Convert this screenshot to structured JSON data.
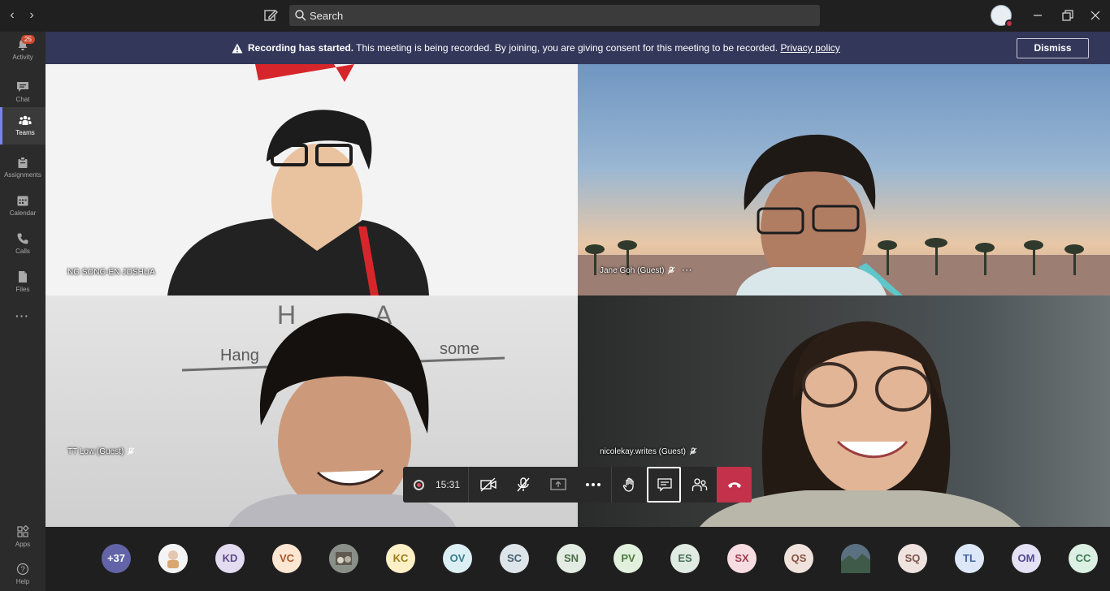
{
  "topbar": {
    "search_placeholder": "Search"
  },
  "rail": {
    "items": [
      {
        "label": "Activity",
        "badge": "25"
      },
      {
        "label": "Chat"
      },
      {
        "label": "Teams"
      },
      {
        "label": "Assignments"
      },
      {
        "label": "Calendar"
      },
      {
        "label": "Calls"
      },
      {
        "label": "Files"
      },
      {
        "label": "Apps"
      },
      {
        "label": "Help"
      }
    ]
  },
  "banner": {
    "bold": "Recording has started.",
    "text": " This meeting is being recorded. By joining, you are giving consent for this meeting to be recorded. ",
    "link": "Privacy policy",
    "dismiss": "Dismiss"
  },
  "tiles": [
    {
      "name": "NG SONG-EN JOSHUA"
    },
    {
      "name": "Jane Goh (Guest)"
    },
    {
      "name": "TT Low (Guest)"
    },
    {
      "name": "nicolekay.writes (Guest)"
    }
  ],
  "controls": {
    "timer": "15:31"
  },
  "participants": [
    {
      "initials": "+37",
      "bg": "#6264a7",
      "fg": "#ffffff"
    },
    {
      "initials": "",
      "bg": "#f4f4f4",
      "fg": "#333333"
    },
    {
      "initials": "KD",
      "bg": "#e3dcf1",
      "fg": "#5b4a8a"
    },
    {
      "initials": "VC",
      "bg": "#fde6d2",
      "fg": "#a8572a"
    },
    {
      "initials": "",
      "bg": "#8a8f88",
      "fg": "#333333"
    },
    {
      "initials": "KC",
      "bg": "#fdf0c7",
      "fg": "#9c7a15"
    },
    {
      "initials": "OV",
      "bg": "#dbeff4",
      "fg": "#3a7c8c"
    },
    {
      "initials": "SC",
      "bg": "#dde5ea",
      "fg": "#46606e"
    },
    {
      "initials": "SN",
      "bg": "#e3ece2",
      "fg": "#4c6b48"
    },
    {
      "initials": "PV",
      "bg": "#e2f0de",
      "fg": "#4a7b3c"
    },
    {
      "initials": "ES",
      "bg": "#e0ebe4",
      "fg": "#4a6f57"
    },
    {
      "initials": "SX",
      "bg": "#f7dde2",
      "fg": "#a13c50"
    },
    {
      "initials": "QS",
      "bg": "#f0e2dc",
      "fg": "#8a5443"
    },
    {
      "initials": "",
      "bg": "#4f6257",
      "fg": "#ffffff"
    },
    {
      "initials": "SQ",
      "bg": "#efe3e0",
      "fg": "#7c5449"
    },
    {
      "initials": "TL",
      "bg": "#dce8f7",
      "fg": "#3f64a0"
    },
    {
      "initials": "OM",
      "bg": "#e3e1f3",
      "fg": "#514a94"
    },
    {
      "initials": "CC",
      "bg": "#dcefe3",
      "fg": "#3d7a52"
    }
  ]
}
